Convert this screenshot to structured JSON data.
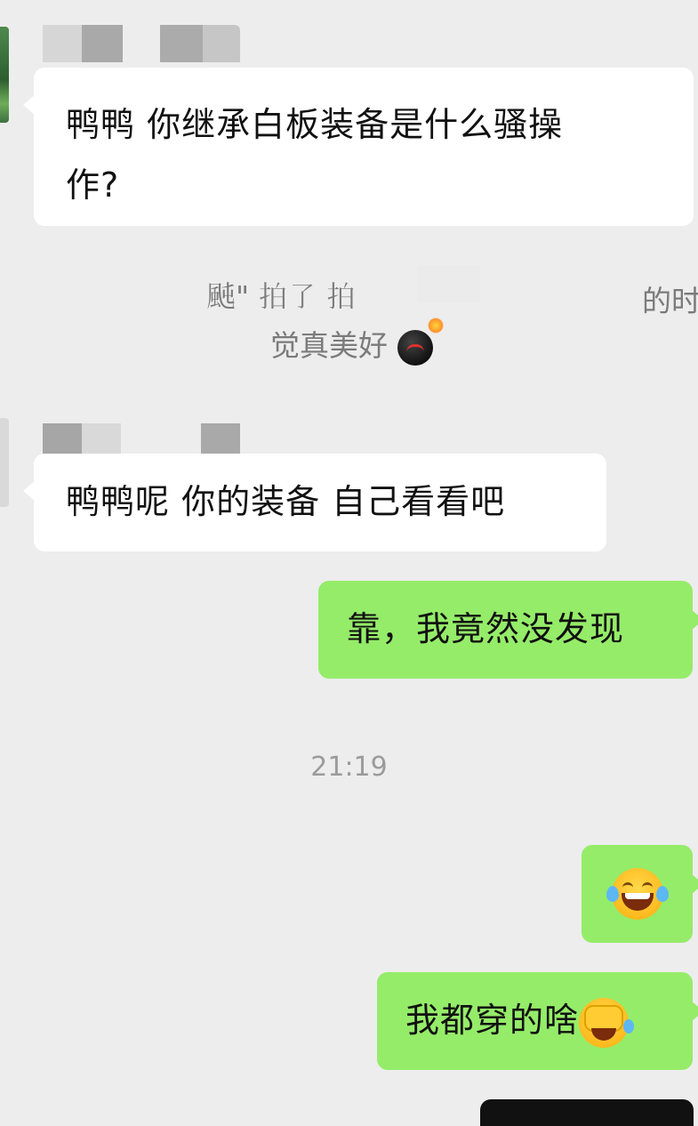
{
  "messages": [
    {
      "side": "in",
      "text_line1": "鸭鸭 你继承白板装备是什么骚操",
      "text_line2": "作?"
    },
    {
      "side": "in",
      "text": "鸭鸭呢 你的装备 自己看看吧"
    },
    {
      "side": "out",
      "text": "靠，我竟然没发现"
    },
    {
      "side": "out",
      "emoji": "face-with-tears-of-joy"
    },
    {
      "side": "out",
      "text": "我都穿的啥",
      "emoji": "face-palm-crying"
    }
  ],
  "system_message": {
    "line1_left": "𩖤\" 拍了 拍",
    "line1_right": "的时",
    "line2": "觉真美好",
    "line2_emoji": "bomb"
  },
  "timestamp": "21:19",
  "colors": {
    "background": "#ededed",
    "incoming_bubble": "#ffffff",
    "outgoing_bubble": "#95ec69",
    "system_text": "#7b7b7b",
    "timestamp_text": "#9b9b9b"
  }
}
